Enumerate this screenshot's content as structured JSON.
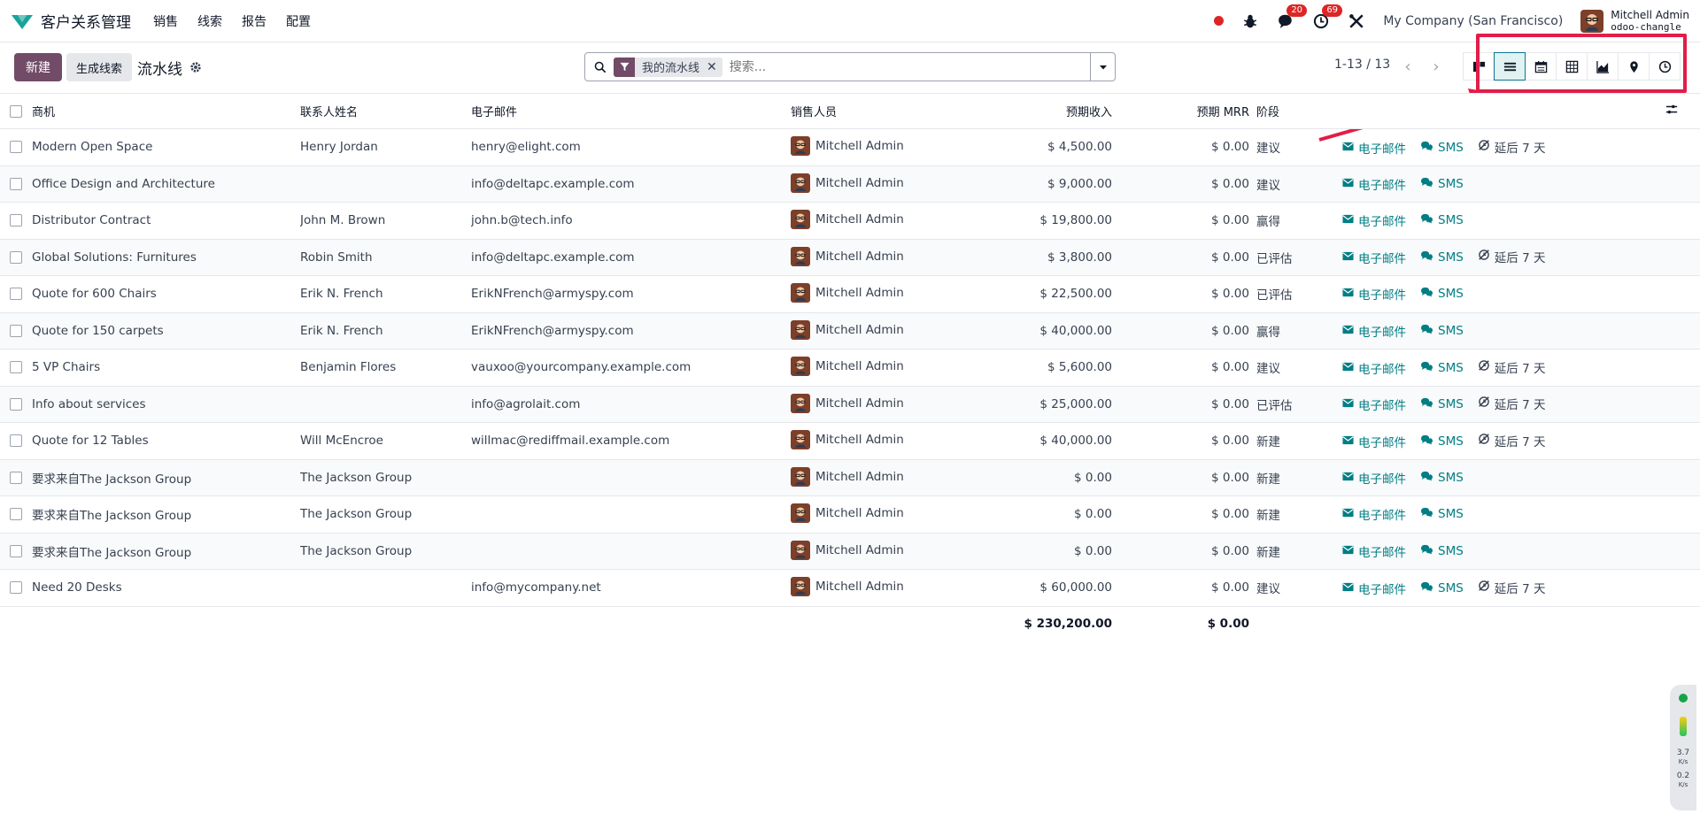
{
  "navbar": {
    "app_name": "客户关系管理",
    "menu": [
      "销售",
      "线索",
      "报告",
      "配置"
    ],
    "messages_count": "20",
    "activities_count": "69",
    "company": "My Company (San Francisco)",
    "user_name": "Mitchell Admin",
    "db_name": "odoo-changle"
  },
  "control": {
    "new_label": "新建",
    "generate_label": "生成线索",
    "title": "流水线",
    "facet_label": "我的流水线",
    "search_placeholder": "搜索...",
    "pager": "1-13 / 13",
    "views": [
      "kanban-icon",
      "list-icon",
      "calendar-icon",
      "pivot-icon",
      "graph-icon",
      "map-icon",
      "activity-icon"
    ],
    "active_view": "list-icon"
  },
  "table": {
    "headers": {
      "name": "商机",
      "contact": "联系人姓名",
      "email": "电子邮件",
      "salesperson": "销售人员",
      "revenue": "预期收入",
      "mrr": "预期 MRR",
      "stage": "阶段"
    },
    "action_email": "电子邮件",
    "action_sms": "SMS",
    "action_postpone": "延后 7 天",
    "rows": [
      {
        "name": "Modern Open Space",
        "contact": "Henry Jordan",
        "email": "henry@elight.com",
        "salesperson": "Mitchell Admin",
        "revenue": "$ 4,500.00",
        "mrr": "$ 0.00",
        "stage": "建议",
        "postpone": true
      },
      {
        "name": "Office Design and Architecture",
        "contact": "",
        "email": "info@deltapc.example.com",
        "salesperson": "Mitchell Admin",
        "revenue": "$ 9,000.00",
        "mrr": "$ 0.00",
        "stage": "建议",
        "postpone": false
      },
      {
        "name": "Distributor Contract",
        "contact": "John M. Brown",
        "email": "john.b@tech.info",
        "salesperson": "Mitchell Admin",
        "revenue": "$ 19,800.00",
        "mrr": "$ 0.00",
        "stage": "赢得",
        "postpone": false
      },
      {
        "name": "Global Solutions: Furnitures",
        "contact": "Robin Smith",
        "email": "info@deltapc.example.com",
        "salesperson": "Mitchell Admin",
        "revenue": "$ 3,800.00",
        "mrr": "$ 0.00",
        "stage": "已评估",
        "postpone": true
      },
      {
        "name": "Quote for 600 Chairs",
        "contact": "Erik N. French",
        "email": "ErikNFrench@armyspy.com",
        "salesperson": "Mitchell Admin",
        "revenue": "$ 22,500.00",
        "mrr": "$ 0.00",
        "stage": "已评估",
        "postpone": false
      },
      {
        "name": "Quote for 150 carpets",
        "contact": "Erik N. French",
        "email": "ErikNFrench@armyspy.com",
        "salesperson": "Mitchell Admin",
        "revenue": "$ 40,000.00",
        "mrr": "$ 0.00",
        "stage": "赢得",
        "postpone": false
      },
      {
        "name": "5 VP Chairs",
        "contact": "Benjamin Flores",
        "email": "vauxoo@yourcompany.example.com",
        "salesperson": "Mitchell Admin",
        "revenue": "$ 5,600.00",
        "mrr": "$ 0.00",
        "stage": "建议",
        "postpone": true
      },
      {
        "name": "Info about services",
        "contact": "",
        "email": "info@agrolait.com",
        "salesperson": "Mitchell Admin",
        "revenue": "$ 25,000.00",
        "mrr": "$ 0.00",
        "stage": "已评估",
        "postpone": true
      },
      {
        "name": "Quote for 12 Tables",
        "contact": "Will McEncroe",
        "email": "willmac@rediffmail.example.com",
        "salesperson": "Mitchell Admin",
        "revenue": "$ 40,000.00",
        "mrr": "$ 0.00",
        "stage": "新建",
        "postpone": true
      },
      {
        "name": "要求来自The Jackson Group",
        "contact": "The Jackson Group",
        "email": "",
        "salesperson": "Mitchell Admin",
        "revenue": "$ 0.00",
        "mrr": "$ 0.00",
        "stage": "新建",
        "postpone": false
      },
      {
        "name": "要求来自The Jackson Group",
        "contact": "The Jackson Group",
        "email": "",
        "salesperson": "Mitchell Admin",
        "revenue": "$ 0.00",
        "mrr": "$ 0.00",
        "stage": "新建",
        "postpone": false
      },
      {
        "name": "要求来自The Jackson Group",
        "contact": "The Jackson Group",
        "email": "",
        "salesperson": "Mitchell Admin",
        "revenue": "$ 0.00",
        "mrr": "$ 0.00",
        "stage": "新建",
        "postpone": false
      },
      {
        "name": "Need 20 Desks",
        "contact": "",
        "email": "info@mycompany.net",
        "salesperson": "Mitchell Admin",
        "revenue": "$ 60,000.00",
        "mrr": "$ 0.00",
        "stage": "建议",
        "postpone": true
      }
    ],
    "total_revenue": "$ 230,200.00",
    "total_mrr": "$ 0.00"
  },
  "widget": {
    "up": "3.7",
    "up_unit": "K/s",
    "down": "0.2",
    "down_unit": "K/s"
  },
  "colors": {
    "brand": "#714b67",
    "action": "#017e84",
    "highlight": "#e11d48"
  }
}
